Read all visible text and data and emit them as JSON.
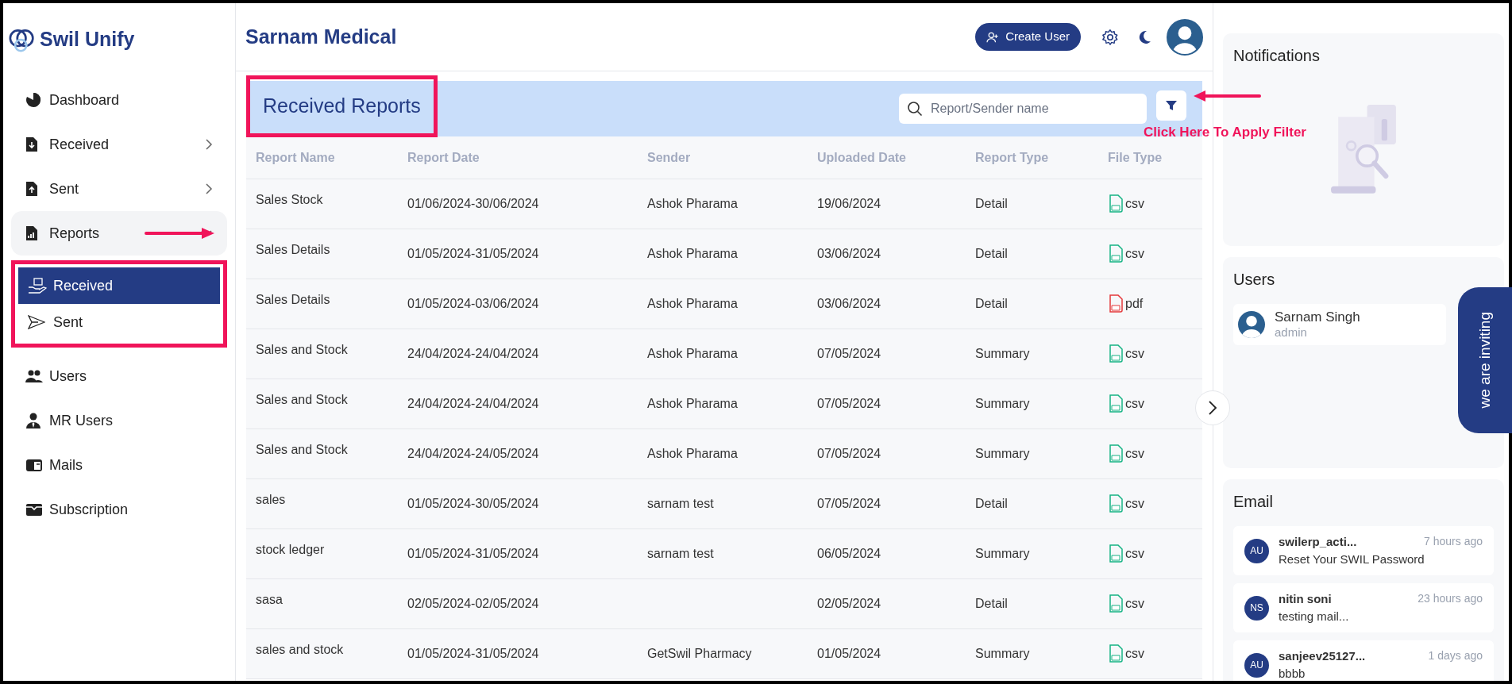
{
  "brand": {
    "name": "Swil Unify"
  },
  "sidebar": {
    "items": [
      {
        "label": "Dashboard"
      },
      {
        "label": "Received",
        "expanded": false
      },
      {
        "label": "Sent",
        "expanded": false
      },
      {
        "label": "Reports",
        "expanded": true,
        "children": [
          {
            "label": "Received",
            "selected": true
          },
          {
            "label": "Sent",
            "selected": false
          }
        ]
      },
      {
        "label": "Users"
      },
      {
        "label": "MR Users"
      },
      {
        "label": "Mails"
      },
      {
        "label": "Subscription"
      }
    ]
  },
  "header": {
    "title": "Sarnam Medical",
    "create_button": "Create User"
  },
  "panel": {
    "title": "Received Reports",
    "search": {
      "placeholder": "Report/Sender name"
    },
    "hint": "Click Here To Apply Filter"
  },
  "table": {
    "columns": [
      "Report Name",
      "Report Date",
      "Sender",
      "Uploaded Date",
      "Report Type",
      "File Type"
    ],
    "rows": [
      {
        "cells": [
          "Sales Stock",
          "01/06/2024-30/06/2024",
          "Ashok Pharama",
          "19/06/2024",
          "Detail"
        ],
        "kind": "csv",
        "file_type": "csv"
      },
      {
        "cells": [
          "Sales Details",
          "01/05/2024-31/05/2024",
          "Ashok Pharama",
          "03/06/2024",
          "Detail"
        ],
        "kind": "csv",
        "file_type": "csv"
      },
      {
        "cells": [
          "Sales Details",
          "01/05/2024-03/06/2024",
          "Ashok Pharama",
          "03/06/2024",
          "Detail"
        ],
        "kind": "pdf",
        "file_type": "pdf"
      },
      {
        "cells": [
          "Sales and Stock",
          "24/04/2024-24/04/2024",
          "Ashok Pharama",
          "07/05/2024",
          "Summary"
        ],
        "kind": "csv",
        "file_type": "csv"
      },
      {
        "cells": [
          "Sales and Stock",
          "24/04/2024-24/04/2024",
          "Ashok Pharama",
          "07/05/2024",
          "Summary"
        ],
        "kind": "csv",
        "file_type": "csv"
      },
      {
        "cells": [
          "Sales and Stock",
          "24/04/2024-24/05/2024",
          "Ashok Pharama",
          "07/05/2024",
          "Summary"
        ],
        "kind": "csv",
        "file_type": "csv"
      },
      {
        "cells": [
          "sales",
          "01/05/2024-30/05/2024",
          "sarnam test",
          "07/05/2024",
          "Detail"
        ],
        "kind": "csv",
        "file_type": "csv"
      },
      {
        "cells": [
          "stock ledger",
          "01/05/2024-31/05/2024",
          "sarnam test",
          "06/05/2024",
          "Summary"
        ],
        "kind": "csv",
        "file_type": "csv"
      },
      {
        "cells": [
          "sasa",
          "02/05/2024-02/05/2024",
          "",
          "02/05/2024",
          "Detail"
        ],
        "kind": "csv",
        "file_type": "csv"
      },
      {
        "cells": [
          "sales and stock",
          "01/05/2024-31/05/2024",
          "GetSwil Pharmacy",
          "01/05/2024",
          "Summary"
        ],
        "kind": "csv",
        "file_type": "csv"
      }
    ]
  },
  "notifications": {
    "title": "Notifications"
  },
  "users": {
    "title": "Users",
    "items": [
      {
        "name": "Sarnam Singh",
        "role": "admin"
      }
    ]
  },
  "email": {
    "title": "Email",
    "items": [
      {
        "initials": "AU",
        "sender": "swilerp_acti...",
        "time": "7 hours ago",
        "subject": "Reset Your SWIL Password"
      },
      {
        "initials": "NS",
        "sender": "nitin soni",
        "time": "23 hours ago",
        "subject": "testing mail..."
      },
      {
        "initials": "AU",
        "sender": "sanjeev25127...",
        "time": "1 days ago",
        "subject": "bbbb"
      }
    ]
  },
  "invite_tab": {
    "label": "we are inviting"
  }
}
